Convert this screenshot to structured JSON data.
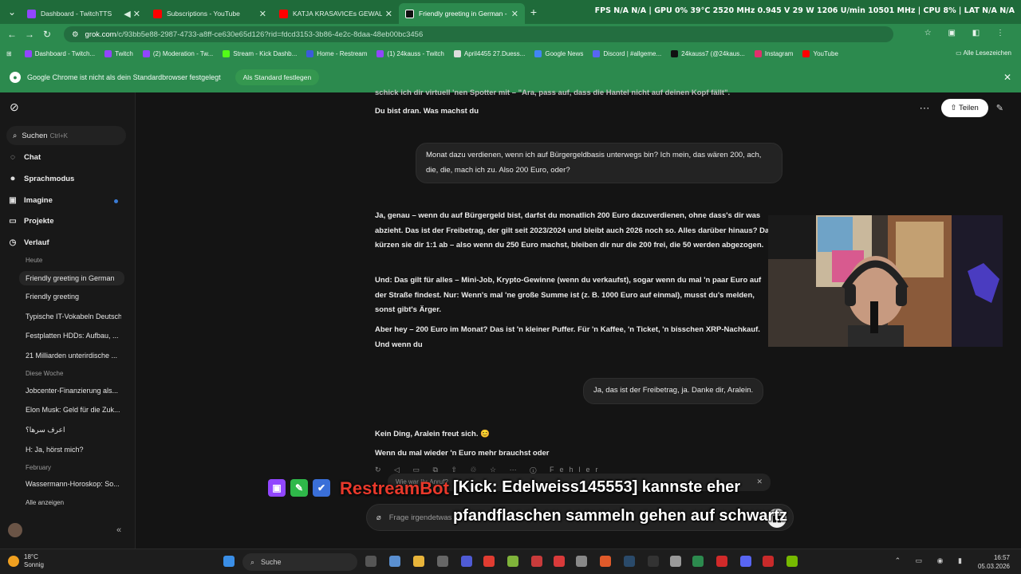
{
  "browser": {
    "tabs": [
      {
        "title": "Dashboard - TwitchTTS",
        "color": "#9146ff"
      },
      {
        "title": "Subscriptions - YouTube",
        "color": "#ff0000"
      },
      {
        "title": "KATJA KRASAVICEs GEWALT in ...",
        "color": "#ff0000"
      },
      {
        "title": "Friendly greeting in German - G",
        "color": "#111111"
      }
    ],
    "new_tab": "+",
    "system_stats": "FPS N/A N/A | GPU 0% 39°C 2520 MHz 0.945 V 29 W 1206 U/min 10501 MHz | CPU 8% | LAT N/A N/A",
    "url_host": "grok.com",
    "url_rest": "/c/93bb5e88-2987-4733-a8ff-ce630e65d126?rid=fdcd3153-3b86-4e2c-8daa-48eb00bc3456",
    "bookmarks": [
      {
        "label": "Dashboard - Twitch...",
        "color": "#9146ff"
      },
      {
        "label": "Twitch",
        "color": "#9146ff"
      },
      {
        "label": "(2) Moderation - Tw...",
        "color": "#9146ff"
      },
      {
        "label": "Stream - Kick Dashb...",
        "color": "#53fc18"
      },
      {
        "label": "Home - Restream",
        "color": "#3b5bdb"
      },
      {
        "label": "(1) 24kauss - Twitch",
        "color": "#9146ff"
      },
      {
        "label": "April4455 27.Duess...",
        "color": "#dddddd"
      },
      {
        "label": "Google News",
        "color": "#4285f4"
      },
      {
        "label": "Discord | #allgeme...",
        "color": "#5865f2"
      },
      {
        "label": "24kauss7 (@24kaus...",
        "color": "#111111"
      },
      {
        "label": "Instagram",
        "color": "#e1306c"
      },
      {
        "label": "YouTube",
        "color": "#ff0000"
      }
    ],
    "all_bookmarks": "Alle Lesezeichen",
    "infobar_text": "Google Chrome ist nicht als dein Standardbrowser festgelegt",
    "infobar_button": "Als Standard festlegen"
  },
  "sidebar": {
    "search_label": "Suchen",
    "search_shortcut": "Ctrl+K",
    "nav": [
      {
        "label": "Chat",
        "icon": "chat-icon"
      },
      {
        "label": "Sprachmodus",
        "icon": "voice-icon"
      },
      {
        "label": "Imagine",
        "icon": "image-icon"
      },
      {
        "label": "Projekte",
        "icon": "folder-icon"
      },
      {
        "label": "Verlauf",
        "icon": "history-icon"
      }
    ],
    "section_today": "Heute",
    "today": [
      "Friendly greeting in German",
      "Friendly greeting",
      "Typische IT-Vokabeln Deutsch",
      "Festplatten HDDs: Aufbau, ...",
      "21 Milliarden unterirdische ..."
    ],
    "section_week": "Diese Woche",
    "week": [
      "Jobcenter-Finanzierung als...",
      "Elon Musk: Geld für die Zuk...",
      "اعرف سرها؟",
      "H: Ja, hörst mich?"
    ],
    "section_feb": "February",
    "february": [
      "Wassermann-Horoskop: So..."
    ],
    "show_all": "Alle anzeigen"
  },
  "header": {
    "share_label": "Teilen"
  },
  "conversation": {
    "top_cut": "schick ich dir virtuell 'nen Spotter mit – \"Ara, pass auf, dass die Hantel nicht auf deinen Kopf fällt\".",
    "ai_1": "Du bist dran. Was machst du",
    "user_1": "Monat dazu verdienen, wenn ich auf Bürgergeldbasis unterwegs bin? Ich mein, das wären 200, ach, die, die, mach ich zu. Also 200 Euro, oder?",
    "ai_2a": "Ja, genau – wenn du auf Bürgergeld bist, darfst du monatlich 200 Euro dazuverdienen, ohne dass's dir was abzieht. Das ist der Freibetrag, der gilt seit 2023/2024 und bleibt auch 2026 noch so. Alles darüber hinaus? Da kürzen sie dir 1:1 ab – also wenn du 250 Euro machst, bleiben dir nur die 200 frei, die 50 werden abgezogen.",
    "ai_2b": "Und: Das gilt für alles – Mini-Job, Krypto-Gewinne (wenn du verkaufst), sogar wenn du mal 'n paar Euro auf der Straße findest. Nur: Wenn's mal 'ne große Summe ist (z. B. 1000 Euro auf einmal), musst du's melden, sonst gibt's Ärger.",
    "ai_2c": "Aber hey – 200 Euro im Monat? Das ist 'n kleiner Puffer. Für 'n Kaffee, 'n Ticket, 'n bisschen XRP-Nachkauf. Und wenn du",
    "user_2": "Ja, das ist der Freibetrag, ja. Danke dir, Aralein.",
    "ai_3a": "Kein Ding, Aralein freut sich. 😊",
    "ai_3b": "Wenn du mal wieder 'n Euro mehr brauchst oder",
    "actions_label": "Fehler",
    "ask_hint": "Wie war Ihr Anruf?",
    "input_placeholder": "Frage irgendetwas"
  },
  "overlay": {
    "bot_name": "RestreamBot",
    "line1": "[Kick: Edelweiss145553] kannste eher",
    "line2": "pfandflaschen sammeln gehen auf schwartz"
  },
  "taskbar": {
    "temp": "18°C",
    "weather": "Sonnig",
    "search": "Suche",
    "time": "16:57",
    "date": "05.03.2026"
  }
}
